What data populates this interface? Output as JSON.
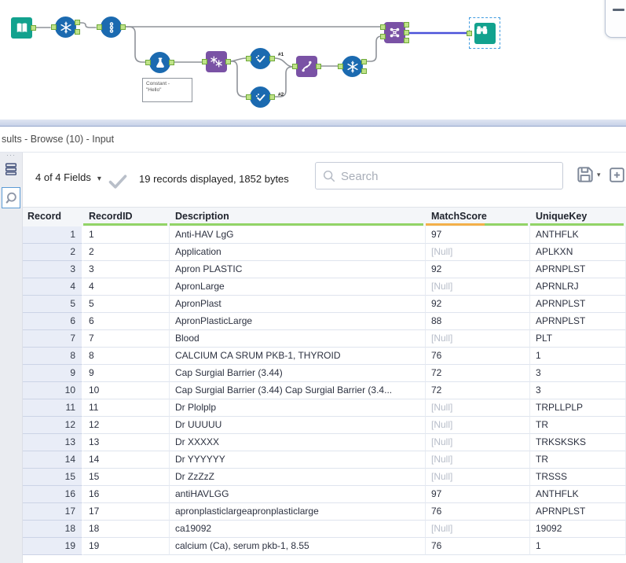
{
  "canvas": {
    "annotation_line1": "Constant -",
    "annotation_line2": "\"Hello\"",
    "label_branch1": "#1",
    "label_branch2": "#2"
  },
  "panel": {
    "title": "sults - Browse (10) - Input",
    "toolbar": {
      "fields_summary": "4 of 4 Fields",
      "dropdown_caret": "▾",
      "records_summary": "19 records displayed, 1852 bytes",
      "search_placeholder": "Search"
    },
    "table": {
      "columns": [
        {
          "label": "Record",
          "quality": "none"
        },
        {
          "label": "RecordID",
          "quality": "green"
        },
        {
          "label": "Description",
          "quality": "green"
        },
        {
          "label": "MatchScore",
          "quality": "split"
        },
        {
          "label": "UniqueKey",
          "quality": "green"
        }
      ],
      "null_text": "[Null]",
      "rows": [
        {
          "record": "1",
          "record_id": "1",
          "description": "Anti-HAV LgG",
          "match_score": "97",
          "unique_key": "ANTHFLK"
        },
        {
          "record": "2",
          "record_id": "2",
          "description": "Application",
          "match_score": "[Null]",
          "unique_key": "APLKXN"
        },
        {
          "record": "3",
          "record_id": "3",
          "description": "Apron PLASTIC",
          "match_score": "92",
          "unique_key": "APRNPLST"
        },
        {
          "record": "4",
          "record_id": "4",
          "description": "ApronLarge",
          "match_score": "[Null]",
          "unique_key": "APRNLRJ"
        },
        {
          "record": "5",
          "record_id": "5",
          "description": "ApronPlast",
          "match_score": "92",
          "unique_key": "APRNPLST"
        },
        {
          "record": "6",
          "record_id": "6",
          "description": "ApronPlasticLarge",
          "match_score": "88",
          "unique_key": "APRNPLST"
        },
        {
          "record": "7",
          "record_id": "7",
          "description": "Blood",
          "match_score": "[Null]",
          "unique_key": "PLT"
        },
        {
          "record": "8",
          "record_id": "8",
          "description": "CALCIUM CA SRUM PKB-1, THYROID",
          "match_score": "76",
          "unique_key": "1"
        },
        {
          "record": "9",
          "record_id": "9",
          "description": "Cap Surgial Barrier (3.44)",
          "match_score": "72",
          "unique_key": "3"
        },
        {
          "record": "10",
          "record_id": "10",
          "description": "Cap Surgial Barrier (3.44) Cap Surgial Barrier (3.4...",
          "match_score": "72",
          "unique_key": "3"
        },
        {
          "record": "11",
          "record_id": "11",
          "description": "Dr Plolplp",
          "match_score": "[Null]",
          "unique_key": "TRPLLPLP"
        },
        {
          "record": "12",
          "record_id": "12",
          "description": "Dr UUUUU",
          "match_score": "[Null]",
          "unique_key": "TR"
        },
        {
          "record": "13",
          "record_id": "13",
          "description": "Dr XXXXX",
          "match_score": "[Null]",
          "unique_key": "TRKSKSKS"
        },
        {
          "record": "14",
          "record_id": "14",
          "description": "Dr YYYYYY",
          "match_score": "[Null]",
          "unique_key": "TR"
        },
        {
          "record": "15",
          "record_id": "15",
          "description": "Dr ZzZzZ",
          "match_score": "[Null]",
          "unique_key": "TRSSS"
        },
        {
          "record": "16",
          "record_id": "16",
          "description": "antiHAVLGG",
          "match_score": "97",
          "unique_key": "ANTHFLK"
        },
        {
          "record": "17",
          "record_id": "17",
          "description": "apronplasticlargeapronplasticlarge",
          "match_score": "76",
          "unique_key": "APRNPLST"
        },
        {
          "record": "18",
          "record_id": "18",
          "description": "ca19092",
          "match_score": "[Null]",
          "unique_key": "19092"
        },
        {
          "record": "19",
          "record_id": "19",
          "description": "calcium (Ca), serum pkb-1, 8.55",
          "match_score": "76",
          "unique_key": "1"
        }
      ]
    },
    "colors": {
      "quality_green": "#92d467",
      "quality_orange": "#f3b04a",
      "connection_blue": "#4b52d9",
      "tool_blue": "#1b6ab0",
      "tool_purple": "#7a52a5",
      "tool_teal": "#12a28e",
      "anchor_green": "#bfe388",
      "null_gray": "#b7bdc9"
    }
  }
}
